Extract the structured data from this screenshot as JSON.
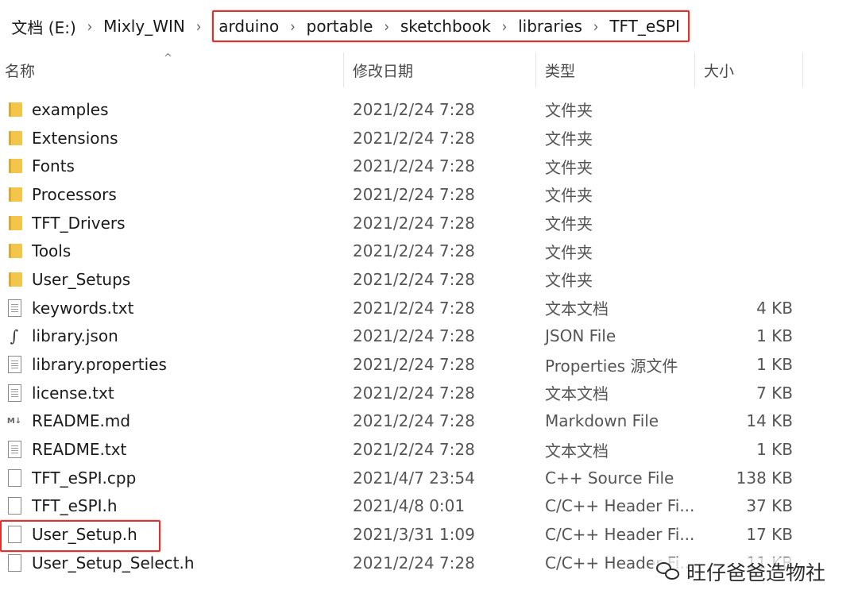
{
  "breadcrumb": {
    "items": [
      "文档 (E:)",
      "Mixly_WIN",
      "arduino",
      "portable",
      "sketchbook",
      "libraries",
      "TFT_eSPI"
    ]
  },
  "columns": {
    "name": "名称",
    "date": "修改日期",
    "type": "类型",
    "size": "大小"
  },
  "files": [
    {
      "name": "examples",
      "date": "2021/2/24 7:28",
      "type": "文件夹",
      "size": "",
      "icon": "folder-icon"
    },
    {
      "name": "Extensions",
      "date": "2021/2/24 7:28",
      "type": "文件夹",
      "size": "",
      "icon": "folder-icon"
    },
    {
      "name": "Fonts",
      "date": "2021/2/24 7:28",
      "type": "文件夹",
      "size": "",
      "icon": "folder-icon"
    },
    {
      "name": "Processors",
      "date": "2021/2/24 7:28",
      "type": "文件夹",
      "size": "",
      "icon": "folder-icon"
    },
    {
      "name": "TFT_Drivers",
      "date": "2021/2/24 7:28",
      "type": "文件夹",
      "size": "",
      "icon": "folder-icon"
    },
    {
      "name": "Tools",
      "date": "2021/2/24 7:28",
      "type": "文件夹",
      "size": "",
      "icon": "folder-icon"
    },
    {
      "name": "User_Setups",
      "date": "2021/2/24 7:28",
      "type": "文件夹",
      "size": "",
      "icon": "folder-icon"
    },
    {
      "name": "keywords.txt",
      "date": "2021/2/24 7:28",
      "type": "文本文档",
      "size": "4 KB",
      "icon": "text-file-icon"
    },
    {
      "name": "library.json",
      "date": "2021/2/24 7:28",
      "type": "JSON File",
      "size": "1 KB",
      "icon": "json-file-icon"
    },
    {
      "name": "library.properties",
      "date": "2021/2/24 7:28",
      "type": "Properties 源文件",
      "size": "1 KB",
      "icon": "text-file-icon"
    },
    {
      "name": "license.txt",
      "date": "2021/2/24 7:28",
      "type": "文本文档",
      "size": "7 KB",
      "icon": "text-file-icon"
    },
    {
      "name": "README.md",
      "date": "2021/2/24 7:28",
      "type": "Markdown File",
      "size": "14 KB",
      "icon": "markdown-file-icon"
    },
    {
      "name": "README.txt",
      "date": "2021/2/24 7:28",
      "type": "文本文档",
      "size": "1 KB",
      "icon": "text-file-icon"
    },
    {
      "name": "TFT_eSPI.cpp",
      "date": "2021/4/7 23:54",
      "type": "C++ Source File",
      "size": "138 KB",
      "icon": "blank-file-icon"
    },
    {
      "name": "TFT_eSPI.h",
      "date": "2021/4/8 0:01",
      "type": "C/C++ Header Fi...",
      "size": "37 KB",
      "icon": "blank-file-icon"
    },
    {
      "name": "User_Setup.h",
      "date": "2021/3/31 1:09",
      "type": "C/C++ Header Fi...",
      "size": "17 KB",
      "icon": "blank-file-icon"
    },
    {
      "name": "User_Setup_Select.h",
      "date": "2021/2/24 7:28",
      "type": "C/C++ Header Fi...",
      "size": "11 KB",
      "icon": "blank-file-icon"
    }
  ],
  "watermark": {
    "text": "旺仔爸爸造物社",
    "icon": "wechat-icon"
  },
  "colors": {
    "highlight": "#e0322c",
    "folder": "#f4c54b"
  }
}
